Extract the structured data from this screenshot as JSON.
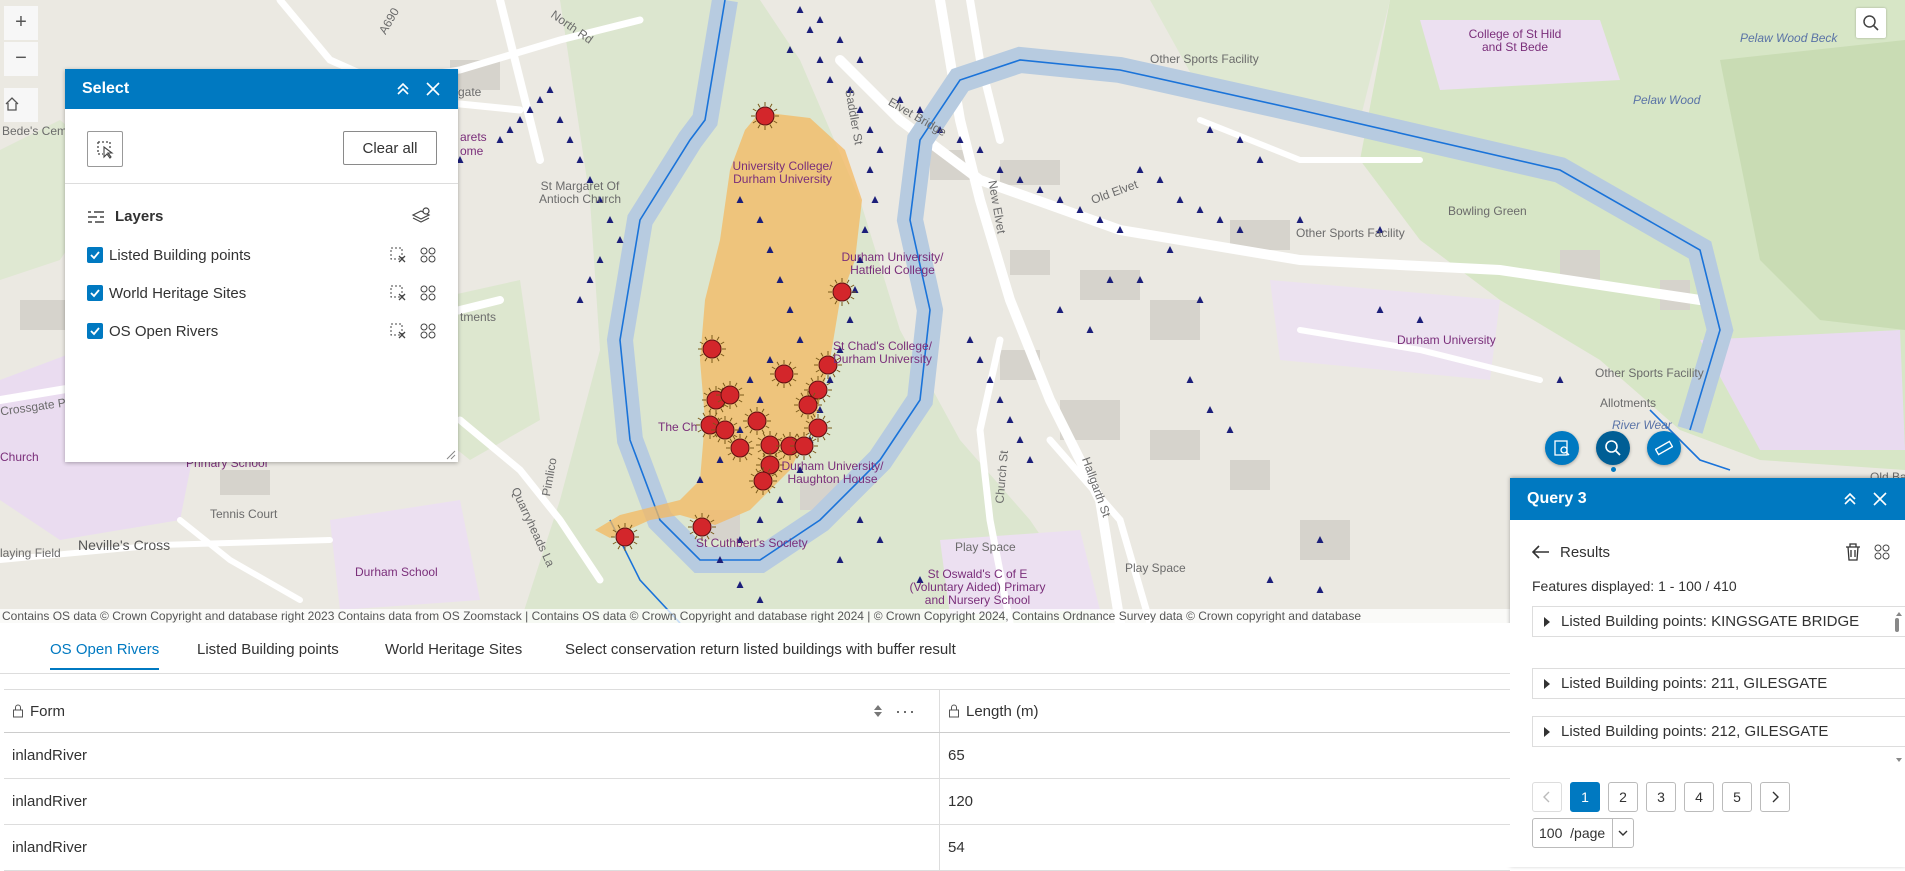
{
  "map": {
    "labels": {
      "north_rd": "North Rd",
      "a690": "A690",
      "gate": "gate",
      "bedes_cem": "Bede's Cem",
      "margarets": "arets",
      "home": "ome",
      "st_margaret": "St Margaret Of Antioch Church",
      "university_college": "University College/ Durham University",
      "hatfield": "Durham University/ Hatfield College",
      "st_chads": "St Chad's College/ Durham University",
      "haughton": "Durham University/ Haughton House",
      "the_ch": "The Ch",
      "st_cuthberts": "St Cuthbert's Society",
      "allotments_left": "tments",
      "crossgate": "Crossgate P",
      "church": "Church",
      "primary_school": "Primary School",
      "tennis_court": "Tennis Court",
      "nevilles_cross": "Neville's Cross",
      "playing_field": "laying Field",
      "durham_school": "Durham School",
      "quarryheads": "Quarryheads La",
      "pimlico": "Pimlico",
      "church_st": "Church St",
      "hallgarth": "Hallgarth St",
      "play_space_1": "Play Space",
      "play_space_2": "Play Space",
      "st_oswalds": "St Oswald's C of E (Voluntary Aided) Primary and Nursery School",
      "new_elvet": "New Elvet",
      "old_elvet": "Old Elvet",
      "elvet_bridge": "Elvet Bridge",
      "saddler": "Saddler St",
      "other_sports_1": "Other Sports Facility",
      "other_sports_2": "Other Sports Facility",
      "other_sports_3": "Other Sports Facility",
      "bowling_green": "Bowling Green",
      "durham_university": "Durham University",
      "allotments": "Allotments",
      "river_wear": "River Wear",
      "college_st_hild": "College of St Hild and St Bede",
      "pelaw_wood_beck": "Pelaw Wood Beck",
      "pelaw_wood": "Pelaw Wood",
      "old_ba": "Old Ba"
    },
    "attribution": "Contains OS data © Crown Copyright and database right 2023 Contains data from OS Zoomstack | Contains OS data © Crown Copyright and database right 2024 | © Crown Copyright 2024, Contains Ordnance Survey data © Crown copyright and database",
    "zoom_in": "+",
    "zoom_out": "−"
  },
  "select_panel": {
    "title": "Select",
    "clear_all": "Clear all",
    "layers_label": "Layers",
    "layers": [
      {
        "name": "Listed Building points",
        "checked": true
      },
      {
        "name": "World Heritage Sites",
        "checked": true
      },
      {
        "name": "OS Open Rivers",
        "checked": true
      }
    ]
  },
  "query_panel": {
    "title": "Query 3",
    "results_label": "Results",
    "features_displayed": "Features displayed: 1 - 100 / 410",
    "results": [
      "Listed Building points: KINGSGATE BRIDGE",
      "Listed Building points: 211, GILESGATE",
      "Listed Building points: 212, GILESGATE"
    ],
    "pages": [
      "1",
      "2",
      "3",
      "4",
      "5"
    ],
    "current_page": "1",
    "per_page_value": "100",
    "per_page_unit": "/page"
  },
  "table": {
    "tabs": [
      "OS Open Rivers",
      "Listed Building points",
      "World Heritage Sites",
      "Select conservation return listed buildings with buffer result"
    ],
    "active_tab": "OS Open Rivers",
    "columns": [
      "Form",
      "Length (m)"
    ],
    "rows": [
      [
        "inlandRiver",
        "65"
      ],
      [
        "inlandRiver",
        "120"
      ],
      [
        "inlandRiver",
        "54"
      ]
    ]
  },
  "colors": {
    "accent": "#0079c1",
    "river": "#1a73d9",
    "heritage": "#f4b860",
    "marker": "#d3262b",
    "triangle": "#1c1f7a"
  }
}
